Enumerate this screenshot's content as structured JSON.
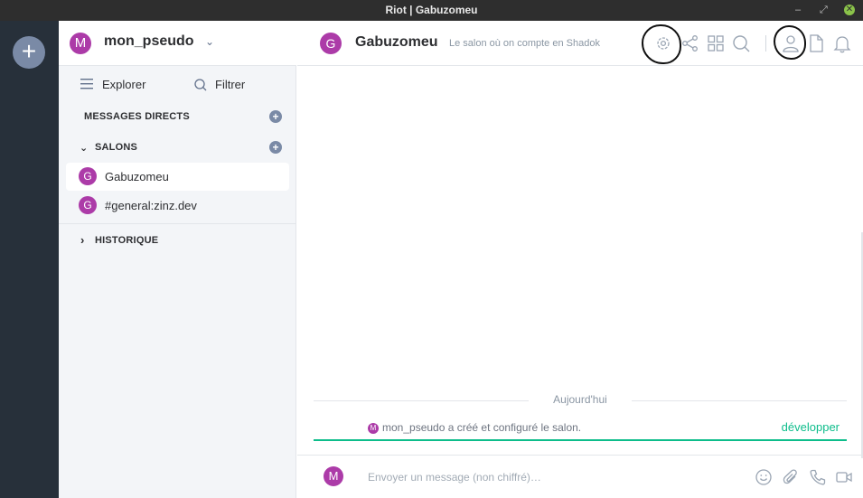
{
  "window": {
    "title": "Riot | Gabuzomeu",
    "minimize_glyph": "–",
    "restore_glyph": "⤢",
    "close_glyph": "✕"
  },
  "leftbar": {
    "add_glyph": "+"
  },
  "user": {
    "avatar_letter": "M",
    "name": "mon_pseudo",
    "menu_glyph": "⌄"
  },
  "nav": {
    "explorer_label": "Explorer",
    "filter_label": "Filtrer"
  },
  "sections": {
    "direct_messages": "MESSAGES DIRECTS",
    "rooms": "SALONS",
    "rooms_chevron": "⌄",
    "history": "HISTORIQUE",
    "history_chevron": "›",
    "add_glyph": "+"
  },
  "rooms": [
    {
      "avatar_letter": "G",
      "name": "Gabuzomeu",
      "selected": true
    },
    {
      "avatar_letter": "G",
      "name": "#general:zinz.dev",
      "selected": false
    }
  ],
  "room_header": {
    "avatar_letter": "G",
    "title": "Gabuzomeu",
    "topic": "Le salon où on compte en Shadok",
    "icons": [
      "settings-icon",
      "share-icon",
      "apps-icon",
      "search-icon",
      "members-icon",
      "files-icon",
      "notifications-icon"
    ]
  },
  "timeline": {
    "date_separator": "Aujourd'hui",
    "event_avatar_letter": "M",
    "event_text": "mon_pseudo a créé et configuré le salon.",
    "expand_label": "développer"
  },
  "composer": {
    "avatar_letter": "M",
    "placeholder": "Envoyer un message (non chiffré)…",
    "icons": [
      "emoji-icon",
      "attachment-icon",
      "voice-call-icon",
      "video-call-icon"
    ]
  },
  "colors": {
    "accent": "#0dbd8b",
    "avatar": "#ac3ba8",
    "leftbar": "#27303a",
    "titlebar": "#2e2e2e"
  }
}
